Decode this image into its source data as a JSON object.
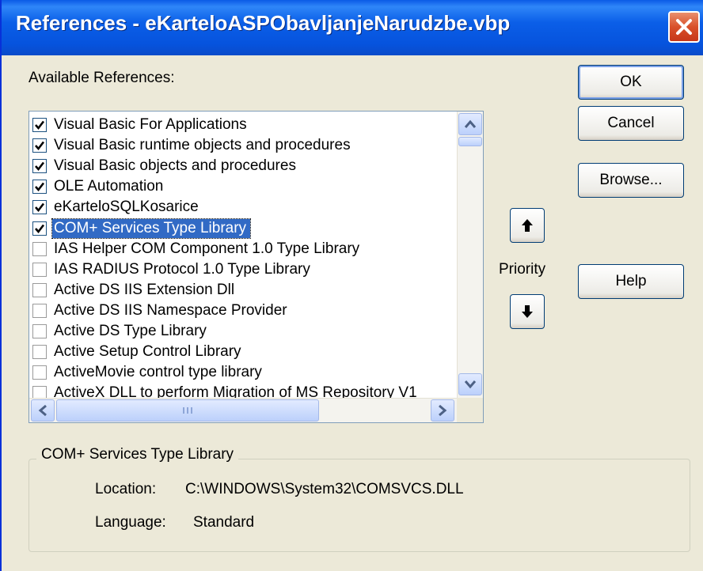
{
  "window": {
    "title": "References - eKarteloASPObavljanjeNarudzbe.vbp"
  },
  "available_label": "Available References:",
  "references": [
    {
      "label": "Visual Basic For Applications",
      "checked": true
    },
    {
      "label": "Visual Basic runtime objects and procedures",
      "checked": true
    },
    {
      "label": "Visual Basic objects and procedures",
      "checked": true
    },
    {
      "label": "OLE Automation",
      "checked": true
    },
    {
      "label": "eKarteloSQLKosarice",
      "checked": true
    },
    {
      "label": "COM+ Services Type Library",
      "checked": true,
      "selected": true
    },
    {
      "label": " IAS Helper COM Component 1.0 Type Library",
      "checked": false
    },
    {
      "label": " IAS RADIUS Protocol 1.0 Type Library",
      "checked": false
    },
    {
      "label": "Active DS IIS Extension Dll",
      "checked": false
    },
    {
      "label": "Active DS IIS Namespace Provider",
      "checked": false
    },
    {
      "label": "Active DS Type Library",
      "checked": false
    },
    {
      "label": "Active Setup Control Library",
      "checked": false
    },
    {
      "label": "ActiveMovie control type library",
      "checked": false
    },
    {
      "label": "ActiveX DLL to perform Migration of MS Repository V1",
      "checked": false
    }
  ],
  "buttons": {
    "ok": "OK",
    "cancel": "Cancel",
    "browse": "Browse...",
    "help": "Help"
  },
  "priority_label": "Priority",
  "details": {
    "title": "COM+ Services Type Library",
    "location_label": "Location:",
    "location_value": "C:\\WINDOWS\\System32\\COMSVCS.DLL",
    "language_label": "Language:",
    "language_value": "Standard"
  },
  "colors": {
    "titlebar": "#0a5ae6",
    "selection": "#316ac5",
    "face": "#ece9d8",
    "close": "#d9502a"
  }
}
